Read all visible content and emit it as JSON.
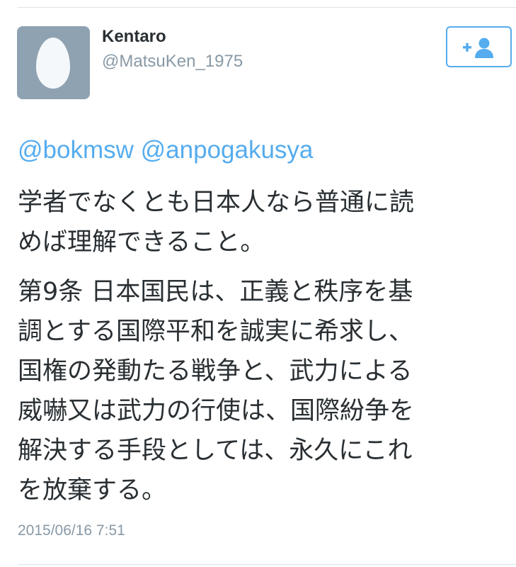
{
  "user": {
    "display_name": "Kentaro",
    "handle": "@MatsuKen_1975",
    "avatar_icon": "default-egg-avatar",
    "avatar_bg": "#8ea2b2"
  },
  "follow_button": {
    "icon": "add-user-icon",
    "accent": "#55acee"
  },
  "tweet": {
    "mentions": [
      "@bokmsw",
      "@anpogakusya"
    ],
    "paragraph1_lines": [
      "学者でなくとも日本人なら普通に読",
      "めば理解できること。"
    ],
    "paragraph2_lines": [
      "第9条 日本国民は、正義と秩序を基",
      "調とする国際平和を誠実に希求し、",
      "国権の発動たる戦争と、武力による",
      "威嚇又は武力の行使は、国際紛争を",
      "解決する手段としては、永久にこれ",
      "を放棄する。"
    ],
    "timestamp": "2015/06/16 7:51"
  },
  "colors": {
    "text": "#292f33",
    "muted": "#8899a6",
    "link": "#55acee"
  }
}
